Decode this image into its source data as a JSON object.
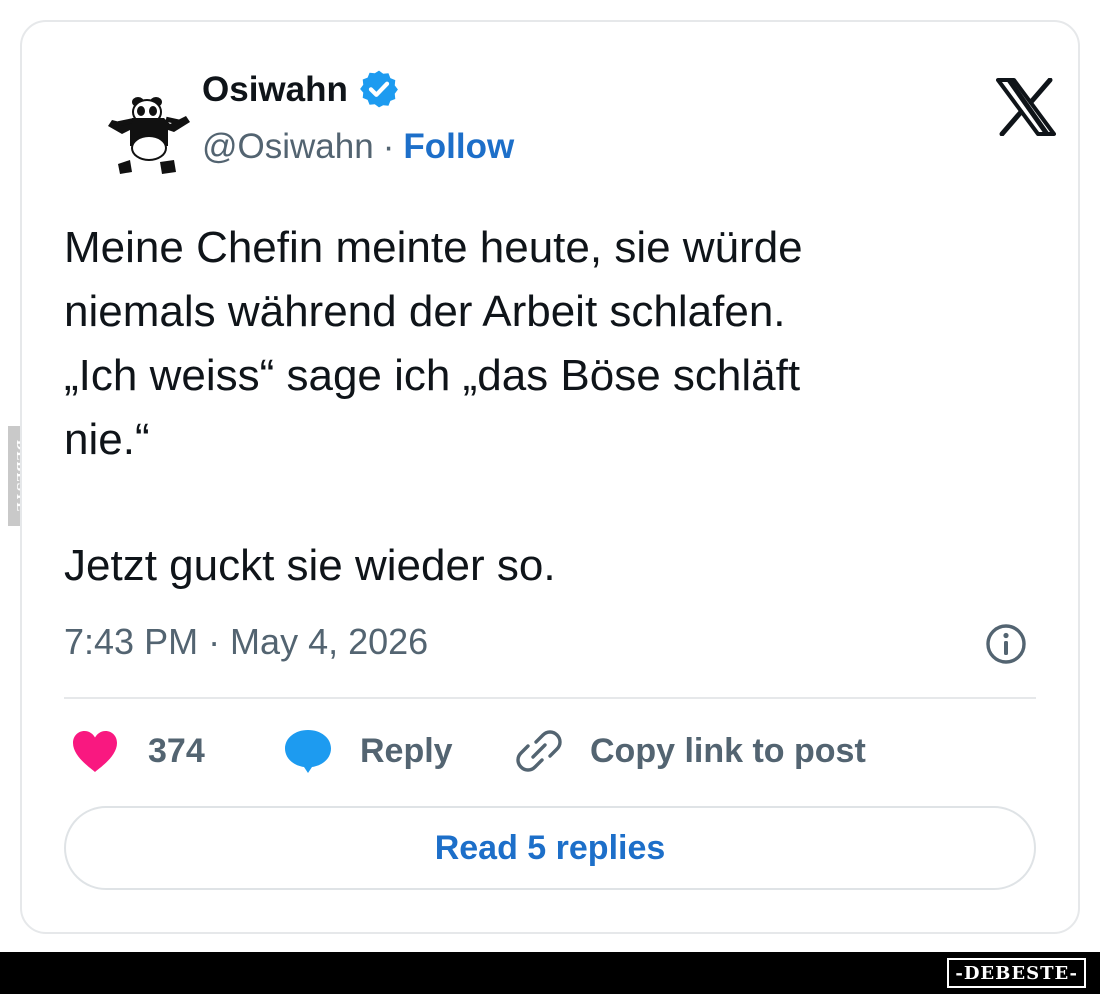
{
  "tweet": {
    "author_name": "Osiwahn",
    "handle": "@Osiwahn",
    "separator": "·",
    "follow_label": "Follow",
    "body_lines": [
      "Meine Chefin meinte heute, sie würde",
      "niemals während der Arbeit schlafen.",
      "„Ich weiss“ sage ich „das Böse schläft",
      "nie.“"
    ],
    "body_last": "Jetzt guckt sie wieder so.",
    "timestamp": "7:43 PM · May 4, 2026"
  },
  "actions": {
    "likes_count": "374",
    "reply_label": "Reply",
    "copy_link_label": "Copy link to post",
    "read_replies_label": "Read 5 replies"
  },
  "icons": {
    "avatar": "panda-avatar",
    "verified": "verified-badge-icon",
    "logo": "x-logo-icon",
    "info": "info-icon",
    "like": "heart-icon",
    "reply": "speech-bubble-icon",
    "link": "link-icon"
  },
  "colors": {
    "like": "#f91880",
    "reply": "#1d9bf0",
    "link_blue": "#1d6fc9",
    "verified": "#1d9bf0",
    "secondary_text": "#536471"
  },
  "watermark": {
    "side_text": "DEBESTE",
    "bottom_text": "-DEBESTE-"
  }
}
